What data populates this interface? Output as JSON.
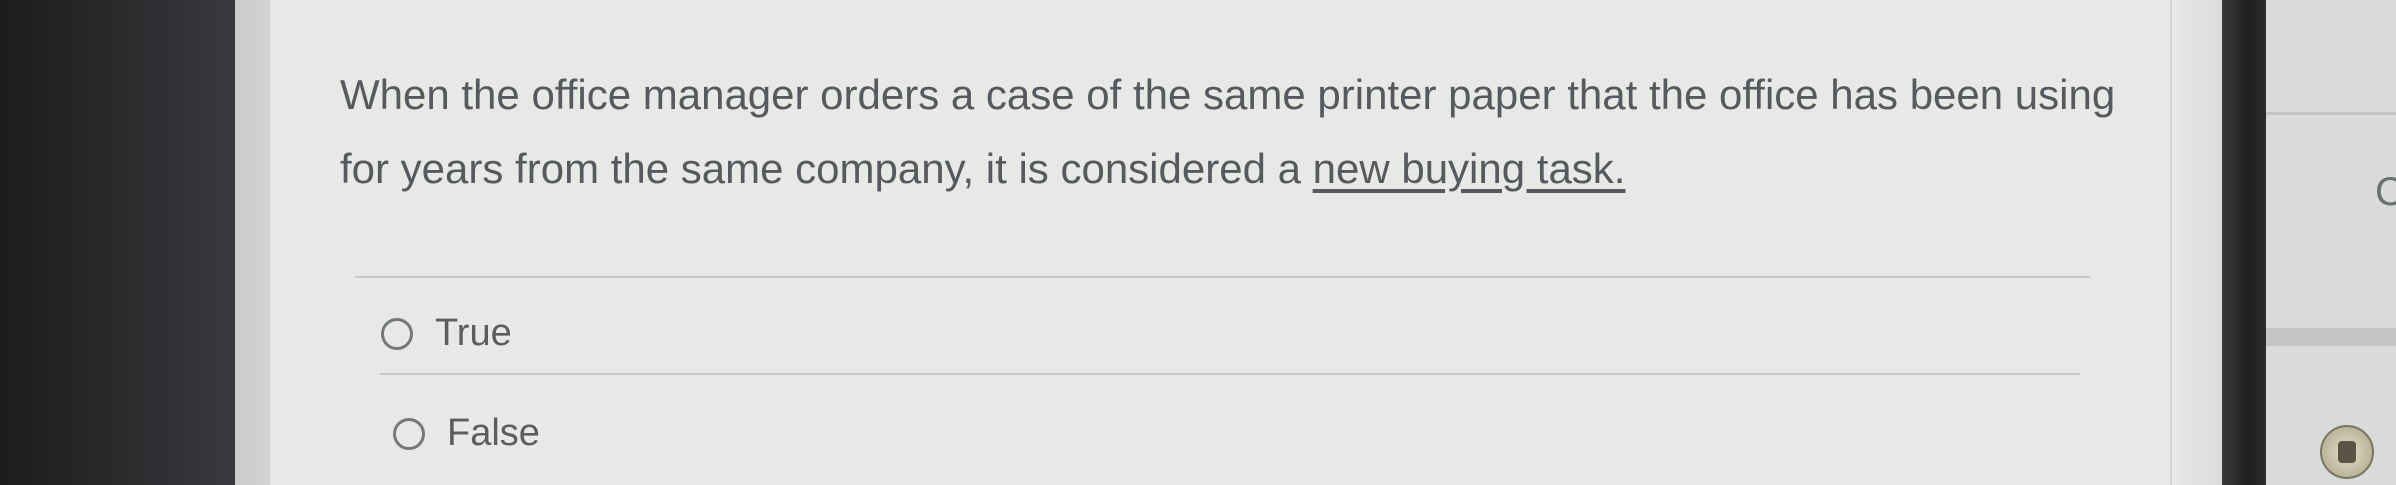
{
  "question": {
    "text_before": "When the office manager orders a case of the same printer paper that the office has been using for years from the same company, it is considered a ",
    "emphasis": "new buying task."
  },
  "options": [
    {
      "label": "True"
    },
    {
      "label": "False"
    }
  ],
  "side_panel": {
    "partial_letter": "C"
  }
}
